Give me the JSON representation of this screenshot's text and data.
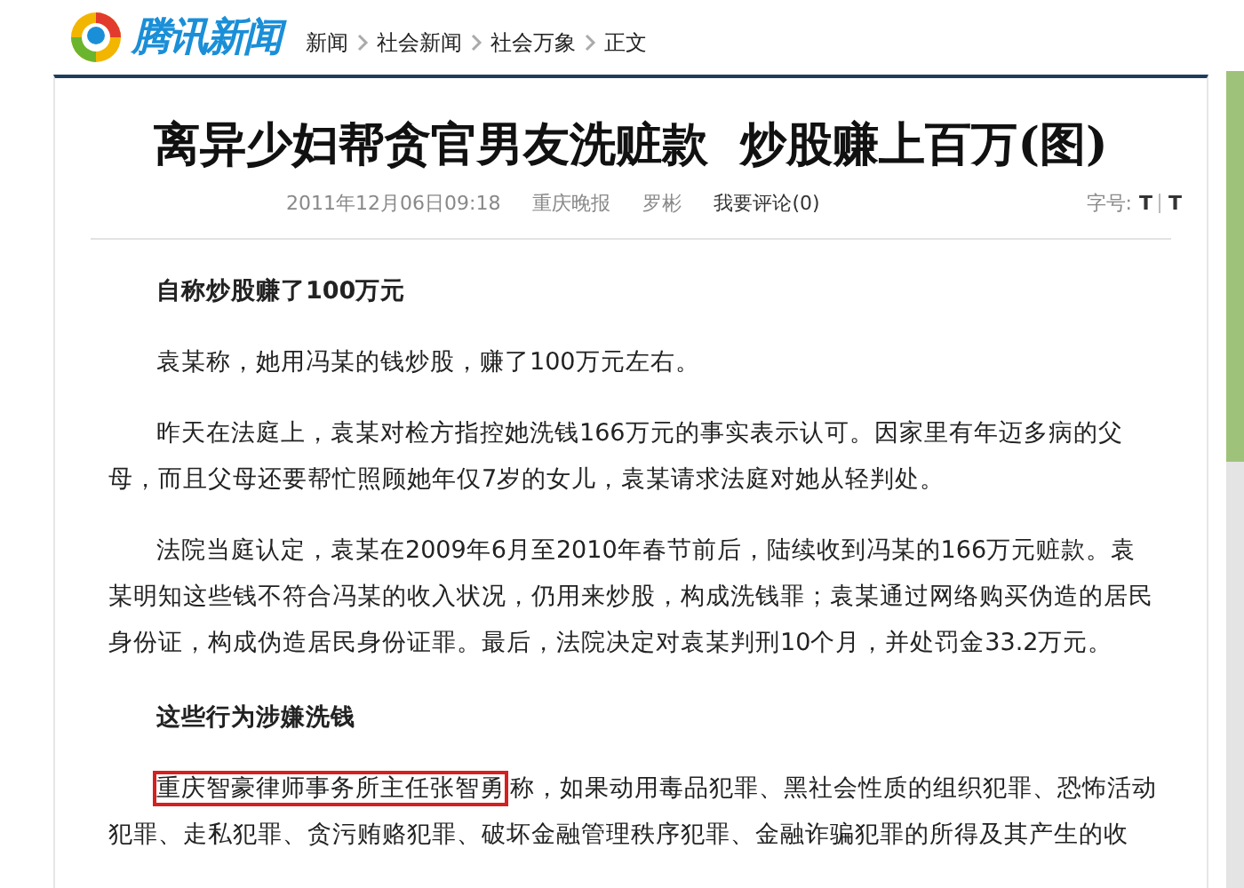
{
  "header": {
    "logo_text": "腾讯新闻",
    "breadcrumb": [
      "新闻",
      "社会新闻",
      "社会万象",
      "正文"
    ]
  },
  "article": {
    "title": "离异少妇帮贪官男友洗赃款  炒股赚上百万(图)",
    "meta": {
      "time": "2011年12月06日09:18",
      "source": "重庆晚报",
      "author": "罗彬",
      "comment_link": "我要评论(0)",
      "font_size_label": "字号:",
      "font_buttons": [
        "T",
        "T"
      ]
    },
    "blocks": [
      {
        "kind": "heading",
        "text": "自称炒股赚了100万元"
      },
      {
        "kind": "paragraph",
        "text": "袁某称，她用冯某的钱炒股，赚了100万元左右。"
      },
      {
        "kind": "paragraph",
        "text": "昨天在法庭上，袁某对检方指控她洗钱166万元的事实表示认可。因家里有年迈多病的父母，而且父母还要帮忙照顾她年仅7岁的女儿，袁某请求法庭对她从轻判处。"
      },
      {
        "kind": "paragraph",
        "text": "法院当庭认定，袁某在2009年6月至2010年春节前后，陆续收到冯某的166万元赃款。袁某明知这些钱不符合冯某的收入状况，仍用来炒股，构成洗钱罪；袁某通过网络购买伪造的居民身份证，构成伪造居民身份证罪。最后，法院决定对袁某判刑10个月，并处罚金33.2万元。"
      },
      {
        "kind": "heading",
        "text": "这些行为涉嫌洗钱"
      },
      {
        "kind": "paragraph",
        "highlight": "重庆智豪律师事务所主任张智勇",
        "text": "称，如果动用毒品犯罪、黑社会性质的组织犯罪、恐怖活动犯罪、走私犯罪、贪污贿赂犯罪、破坏金融管理秩序犯罪、金融诈骗犯罪的所得及其产生的收"
      }
    ]
  }
}
